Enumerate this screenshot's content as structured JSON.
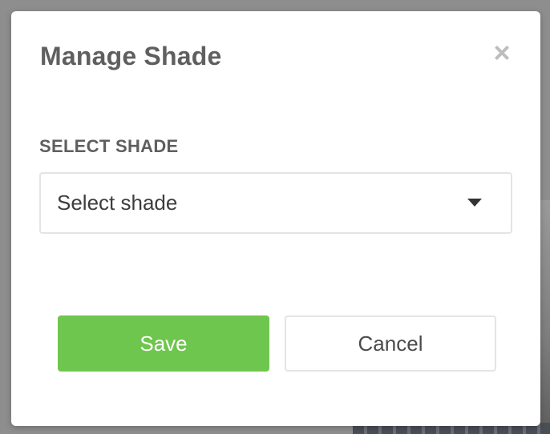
{
  "modal": {
    "title": "Manage Shade",
    "close_glyph": "×",
    "close_icon": "close-icon"
  },
  "form": {
    "select_label": "SELECT SHADE",
    "select_value": "Select shade",
    "select_icon": "caret-down-icon"
  },
  "actions": {
    "save_label": "Save",
    "cancel_label": "Cancel"
  },
  "colors": {
    "primary": "#6fc64e",
    "title_text": "#5f5f5f",
    "overlay": "#8e8e8e"
  }
}
